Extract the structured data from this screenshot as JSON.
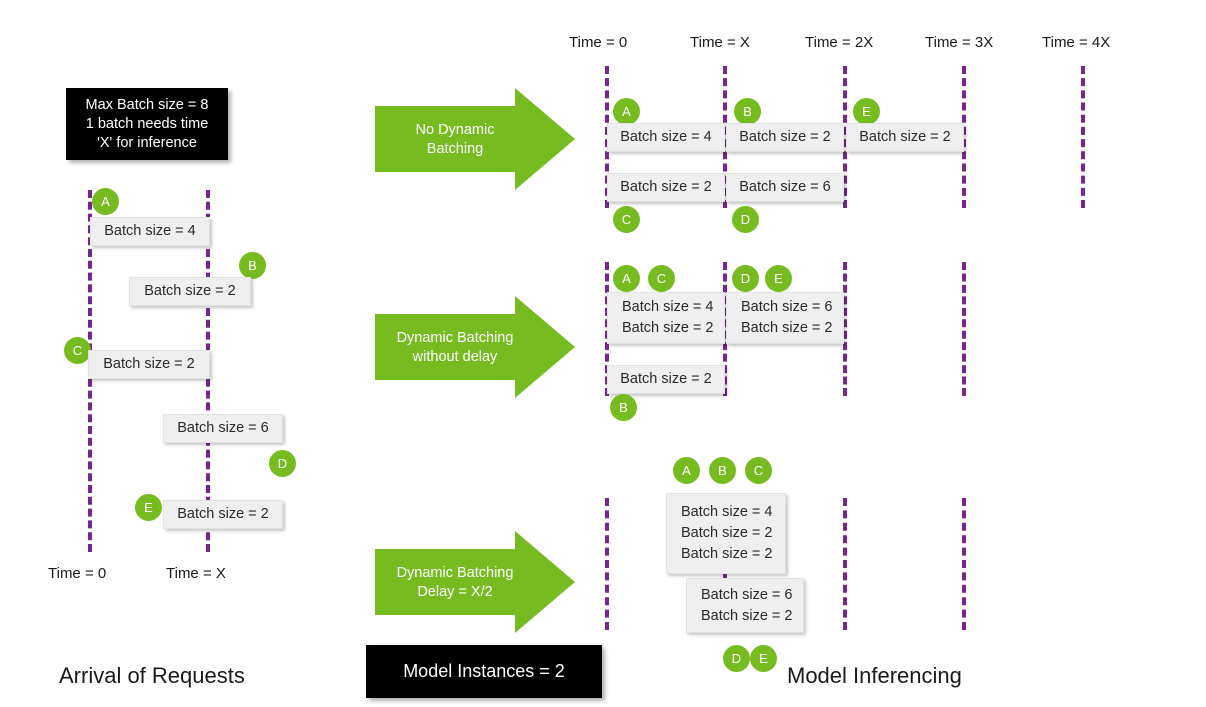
{
  "colors": {
    "green": "#76BC21",
    "purple": "#76278F",
    "box_fill": "#EFEFEF",
    "black": "#000000",
    "white": "#FFFFFF"
  },
  "notes": {
    "config": {
      "line1": "Max Batch size = 8",
      "line2": "1 batch needs time",
      "line3": "'X' for inference"
    },
    "model_instances": "Model Instances = 2"
  },
  "titles": {
    "left_panel": "Arrival of Requests",
    "right_panel": "Model Inferencing"
  },
  "left_panel": {
    "axis_labels": [
      {
        "text": "Time = 0"
      },
      {
        "text": "Time = X"
      }
    ],
    "requests": [
      {
        "badge": "A",
        "text": "Batch size = 4"
      },
      {
        "badge": "B",
        "text": "Batch size = 2"
      },
      {
        "badge": "C",
        "text": "Batch size = 2"
      },
      {
        "badge": "D",
        "text": "Batch size = 6"
      },
      {
        "badge": "E",
        "text": "Batch size = 2"
      }
    ]
  },
  "right_panel": {
    "axis_labels": [
      {
        "text": "Time = 0"
      },
      {
        "text": "Time = X"
      },
      {
        "text": "Time = 2X"
      },
      {
        "text": "Time = 3X"
      },
      {
        "text": "Time = 4X"
      }
    ],
    "arrows": [
      {
        "line1": "No Dynamic",
        "line2": "Batching"
      },
      {
        "line1": "Dynamic Batching",
        "line2": "without delay"
      },
      {
        "line1": "Dynamic Batching",
        "line2": "Delay = X/2"
      }
    ],
    "scenarios": [
      {
        "name": "no-dynamic-batching",
        "instances": [
          {
            "slots": [
              {
                "badges": [
                  "A"
                ],
                "lines": [
                  "Batch size = 4"
                ]
              },
              {
                "badges": [
                  "B"
                ],
                "lines": [
                  "Batch size = 2"
                ]
              },
              {
                "badges": [
                  "E"
                ],
                "lines": [
                  "Batch size = 2"
                ]
              }
            ]
          },
          {
            "slots": [
              {
                "badges": [
                  "C"
                ],
                "lines": [
                  "Batch size = 2"
                ]
              },
              {
                "badges": [
                  "D"
                ],
                "lines": [
                  "Batch size = 6"
                ]
              }
            ]
          }
        ]
      },
      {
        "name": "dynamic-batching-without-delay",
        "instances": [
          {
            "slots": [
              {
                "badges": [
                  "A",
                  "C"
                ],
                "lines": [
                  "Batch size = 4",
                  "Batch size = 2"
                ]
              },
              {
                "badges": [
                  "D",
                  "E"
                ],
                "lines": [
                  "Batch size = 6",
                  "Batch size = 2"
                ]
              }
            ]
          },
          {
            "slots": [
              {
                "badges": [
                  "B"
                ],
                "lines": [
                  "Batch size = 2"
                ]
              }
            ]
          }
        ]
      },
      {
        "name": "dynamic-batching-delay-half-x",
        "instances": [
          {
            "slots": [
              {
                "badges": [
                  "A",
                  "B",
                  "C"
                ],
                "lines": [
                  "Batch size = 4",
                  "Batch size = 2",
                  "Batch size = 2"
                ]
              }
            ]
          },
          {
            "slots": [
              {
                "badges": [
                  "D",
                  "E"
                ],
                "lines": [
                  "Batch size = 6",
                  "Batch size = 2"
                ]
              }
            ]
          }
        ]
      }
    ]
  }
}
